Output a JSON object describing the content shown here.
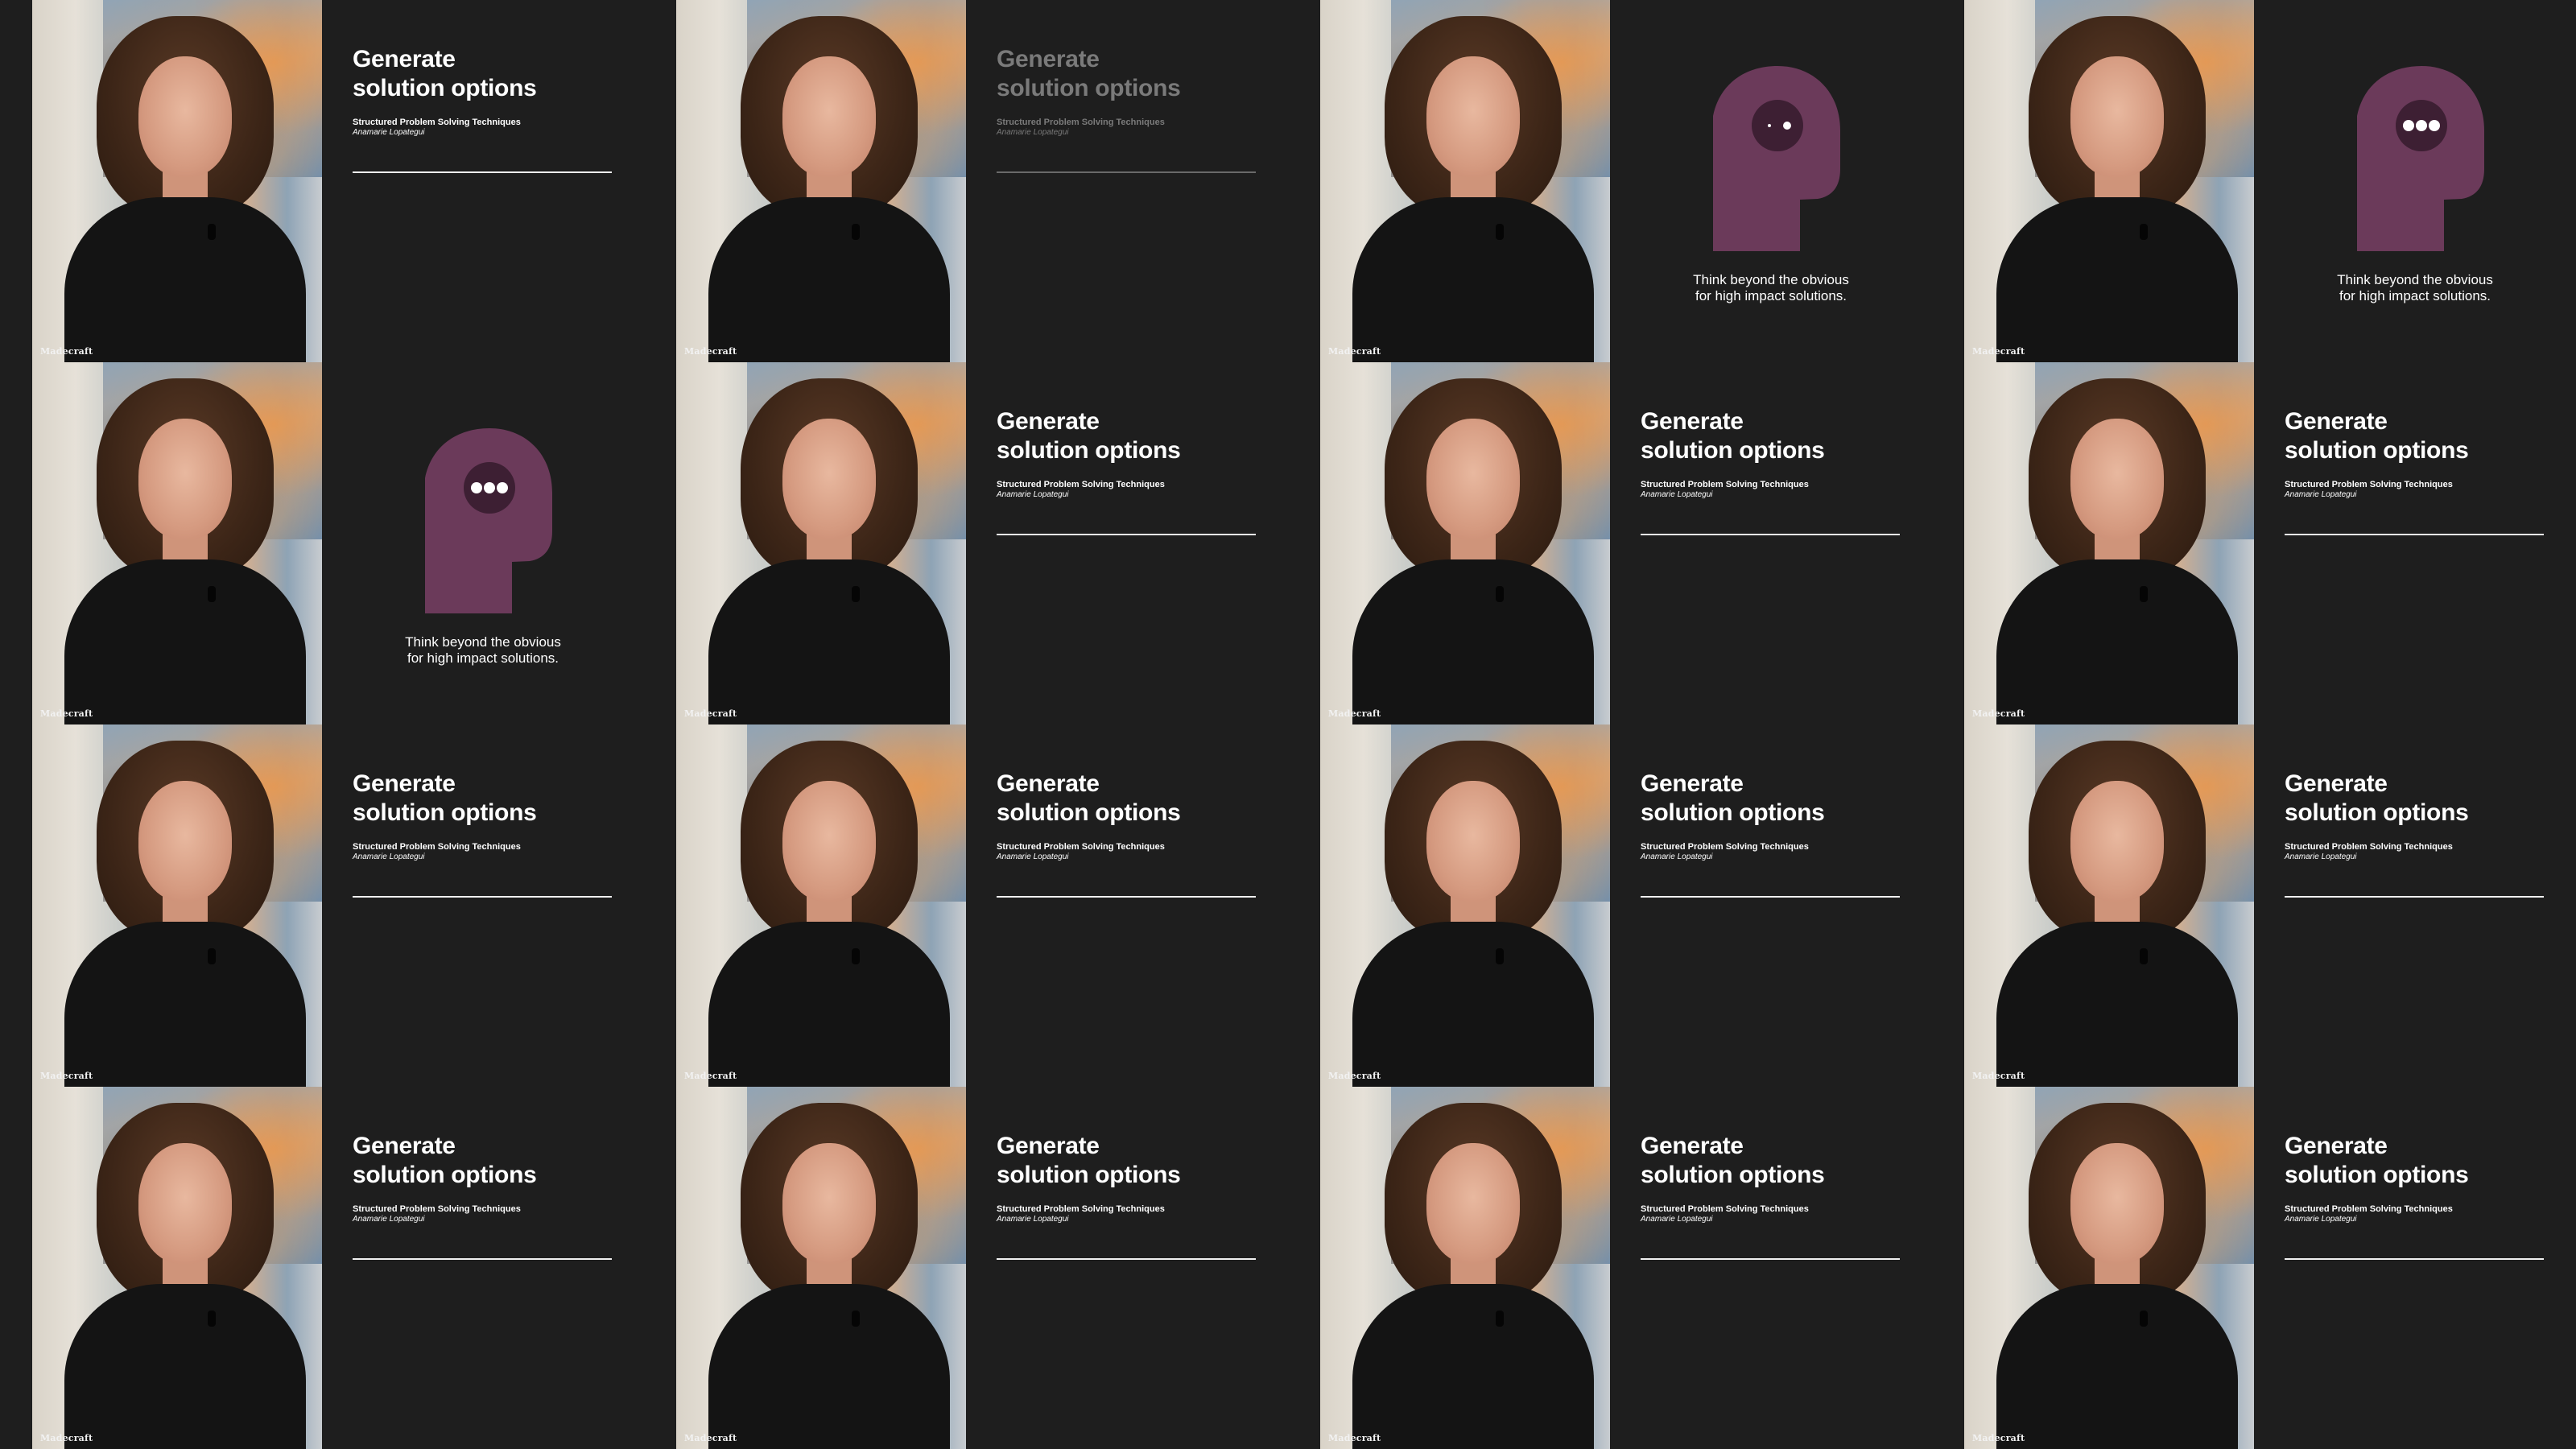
{
  "slide": {
    "title": "Generate\nsolution options",
    "course": "Structured Problem Solving Techniques",
    "author": "Anamarie Lopategui"
  },
  "think_slide": {
    "caption": "Think beyond the obvious\nfor high impact solutions.",
    "icon": "head-with-thought-dots-icon",
    "icon_color": "#6b3a5a",
    "dot_color": "#3d1f33"
  },
  "watermark": "Madecraft",
  "colors": {
    "background": "#1e1e1e",
    "text": "#ffffff",
    "dim_text": "#7a7a7a"
  },
  "frames": [
    {
      "slide": "title",
      "state": "normal"
    },
    {
      "slide": "title",
      "state": "dim"
    },
    {
      "slide": "think",
      "dots": 1
    },
    {
      "slide": "think",
      "dots": 3
    },
    {
      "slide": "think",
      "dots": 3
    },
    {
      "slide": "title",
      "state": "normal"
    },
    {
      "slide": "title",
      "state": "normal"
    },
    {
      "slide": "title",
      "state": "normal"
    },
    {
      "slide": "title",
      "state": "normal"
    },
    {
      "slide": "title",
      "state": "normal"
    },
    {
      "slide": "title",
      "state": "normal"
    },
    {
      "slide": "title",
      "state": "normal"
    },
    {
      "slide": "title",
      "state": "normal"
    },
    {
      "slide": "title",
      "state": "normal"
    },
    {
      "slide": "title",
      "state": "normal"
    },
    {
      "slide": "title",
      "state": "normal"
    }
  ]
}
